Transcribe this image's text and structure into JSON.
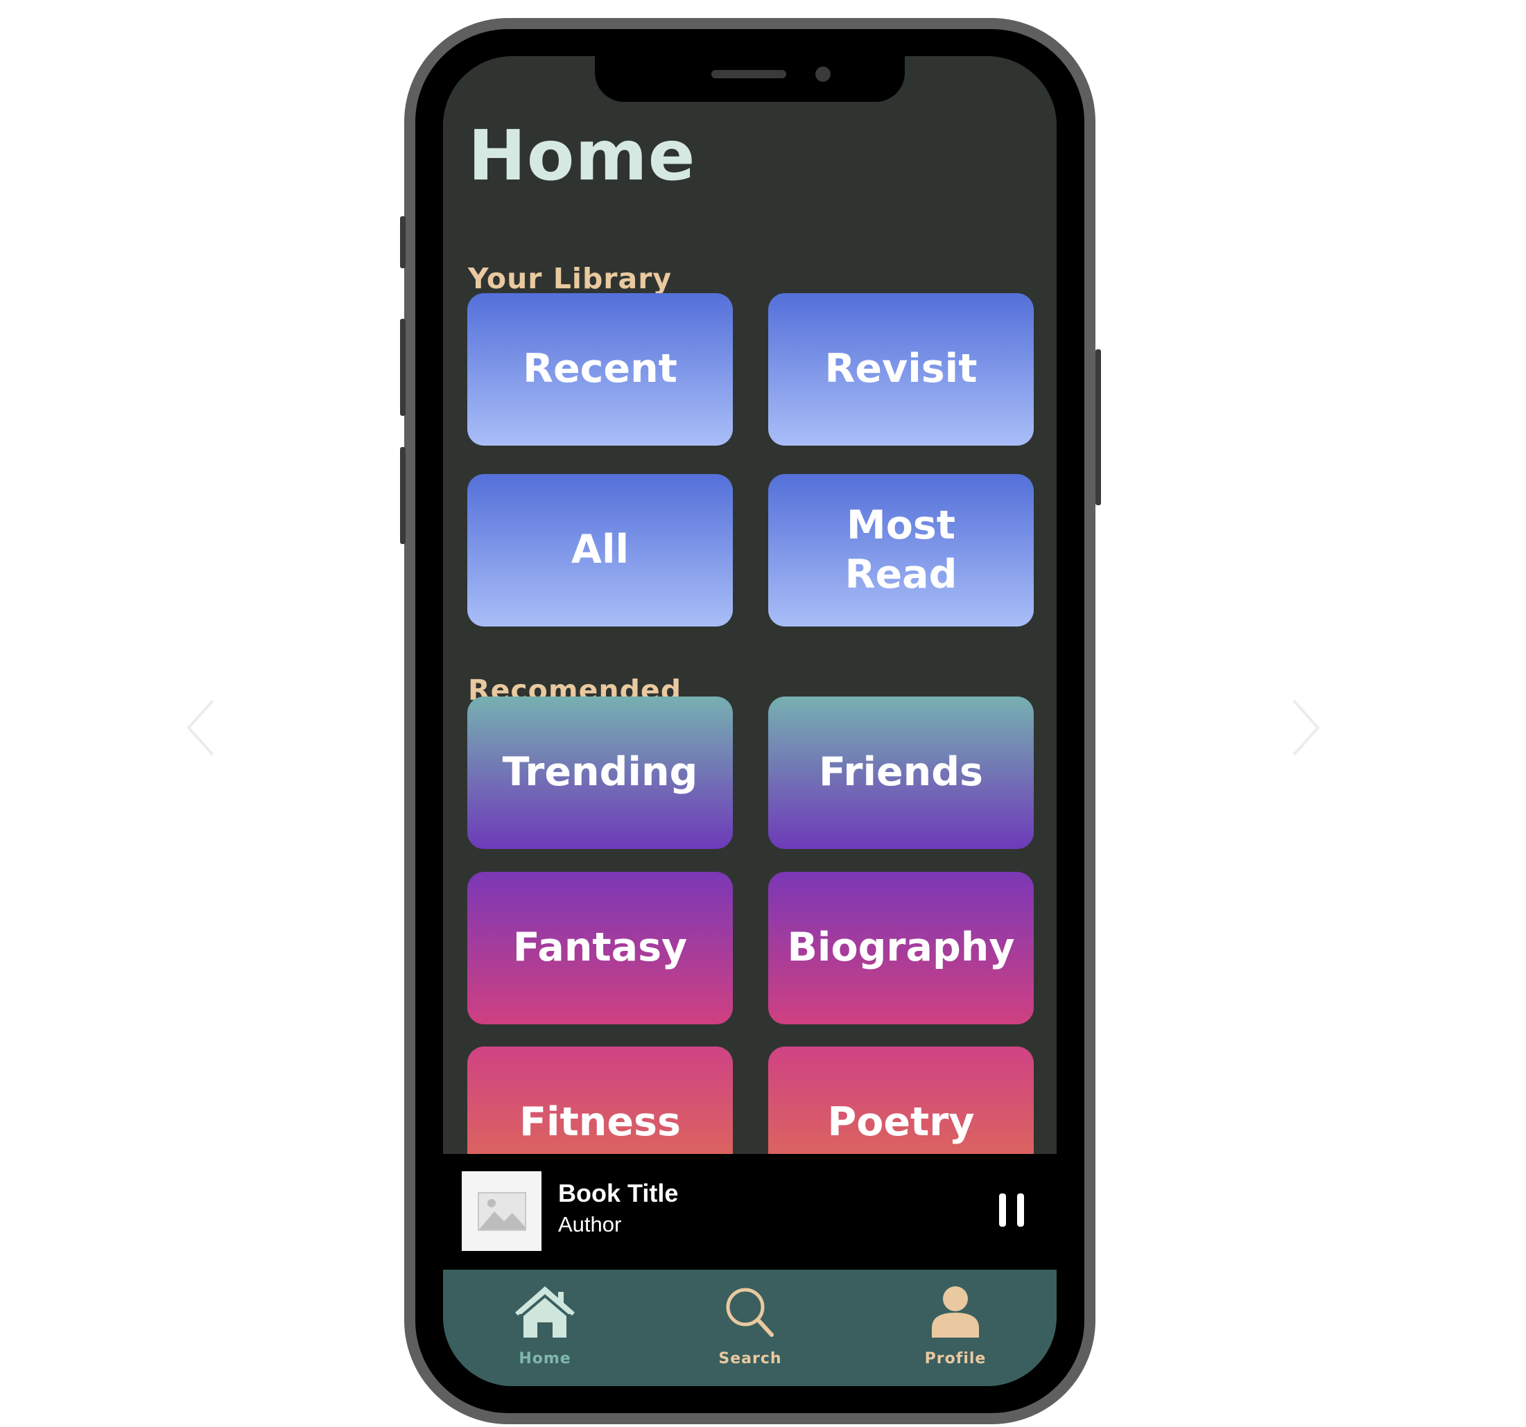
{
  "header": {
    "title": "Home"
  },
  "library": {
    "label": "Your Library",
    "tiles": [
      "Recent",
      "Revisit",
      "All",
      "Most Read"
    ]
  },
  "recommended": {
    "label": "Recomended",
    "tiles": [
      "Trending",
      "Friends",
      "Fantasy",
      "Biography",
      "Fitness",
      "Poetry"
    ]
  },
  "player": {
    "title": "Book Title",
    "author": "Author",
    "thumbnail_icon": "image-placeholder-icon",
    "control_icon": "pause-icon"
  },
  "tabs": [
    {
      "label": "Home",
      "icon": "home-icon",
      "active": true
    },
    {
      "label": "Search",
      "icon": "search-icon",
      "active": false
    },
    {
      "label": "Profile",
      "icon": "profile-icon",
      "active": false
    }
  ],
  "colors": {
    "screen_bg": "#303431",
    "title": "#d6e8e2",
    "section_label": "#eac9a0",
    "tab_bar": "#3b5f5f",
    "tab_active": "#7fb8aa",
    "tab_inactive": "#eac9a0"
  }
}
